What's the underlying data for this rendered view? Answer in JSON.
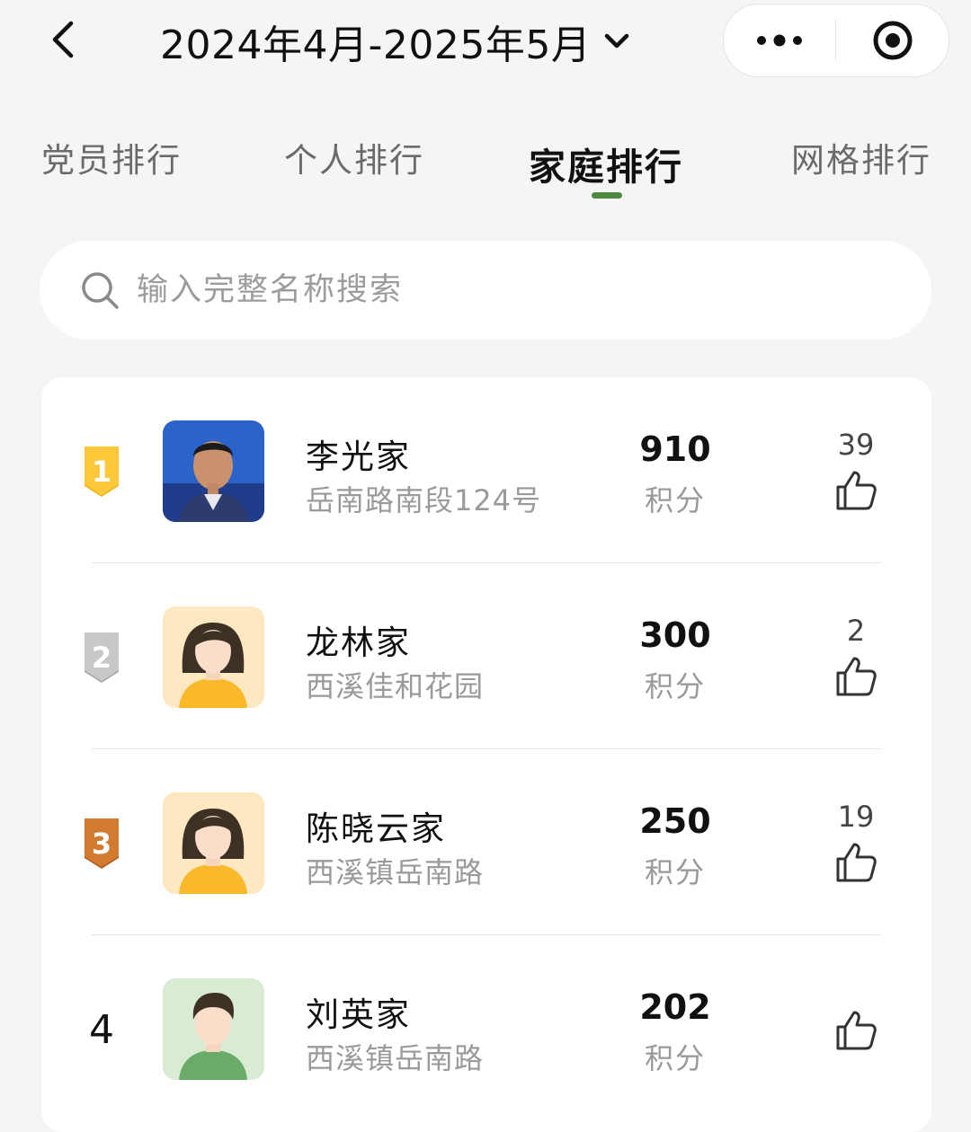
{
  "header": {
    "title": "2024年4月-2025年5月"
  },
  "tabs": [
    {
      "label": "党员排行",
      "active": false
    },
    {
      "label": "个人排行",
      "active": false
    },
    {
      "label": "家庭排行",
      "active": true
    },
    {
      "label": "网格排行",
      "active": false
    }
  ],
  "search": {
    "placeholder": "输入完整名称搜索"
  },
  "score_label": "积分",
  "ranking": [
    {
      "rank": "1",
      "badge": "gold",
      "name": "李光家",
      "address": "岳南路南段124号",
      "score": "910",
      "likes": "39",
      "avatar": "photo"
    },
    {
      "rank": "2",
      "badge": "silver",
      "name": "龙林家",
      "address": "西溪佳和花园",
      "score": "300",
      "likes": "2",
      "avatar": "female"
    },
    {
      "rank": "3",
      "badge": "bronze",
      "name": "陈晓云家",
      "address": "西溪镇岳南路",
      "score": "250",
      "likes": "19",
      "avatar": "female"
    },
    {
      "rank": "4",
      "badge": "",
      "name": "刘英家",
      "address": "西溪镇岳南路",
      "score": "202",
      "likes": "",
      "avatar": "male"
    }
  ],
  "colors": {
    "accent": "#4c8a3e",
    "gold": "#f0b41e",
    "silver": "#b8b8b8",
    "bronze": "#c7702a"
  }
}
